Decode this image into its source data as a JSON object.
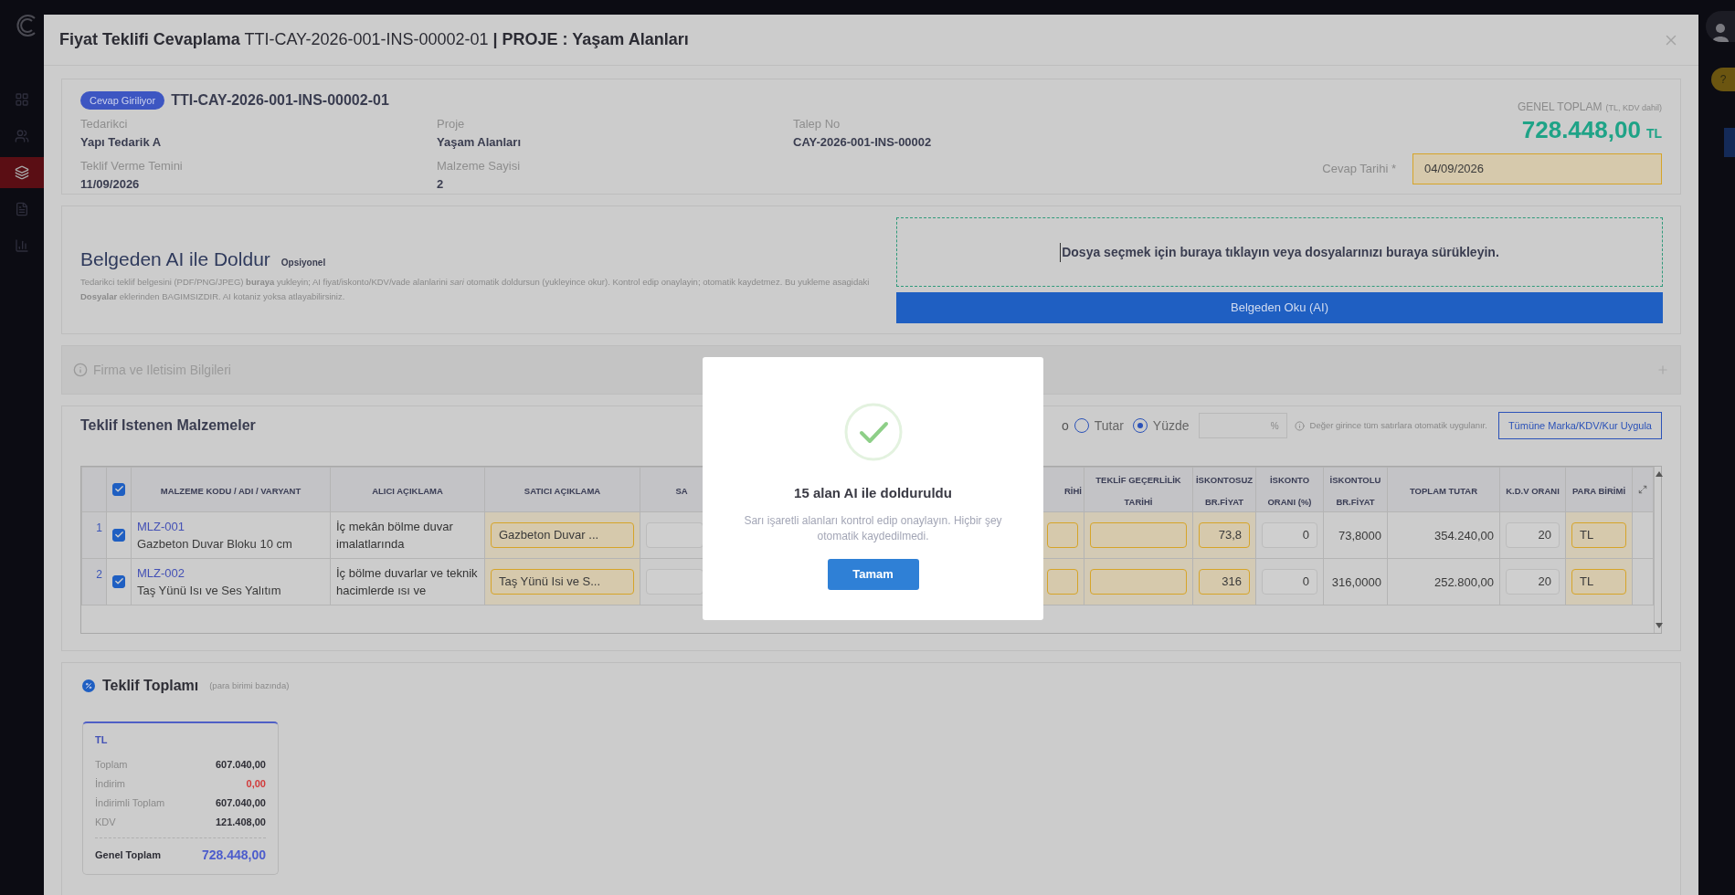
{
  "sidebar": {
    "items": [
      {
        "selected": false
      },
      {
        "selected": false
      },
      {
        "selected": true
      },
      {
        "selected": false
      },
      {
        "selected": false
      }
    ]
  },
  "help_badge": "?",
  "dialog": {
    "title": "**Fiyat Teklifi Cevaplama** TTI-CAY-2026-001-INS-00002-01 **| PROJE : Yaşam Alanları**",
    "header": {
      "status_badge": "Cevap Giriliyor",
      "reference": "TTI-CAY-2026-001-INS-00002-01",
      "fields": [
        {
          "label": "Tedarikci",
          "value": "Yapı Tedarik A"
        },
        {
          "label": "Proje",
          "value": "Yaşam Alanları"
        },
        {
          "label": "Talep No",
          "value": "CAY-2026-001-INS-00002"
        },
        {
          "label": "Teklif Verme Temini",
          "value": "11/09/2026"
        },
        {
          "label": "Malzeme Sayisi",
          "value": "2"
        }
      ],
      "grand_total": {
        "label": "GENEL TOPLAM",
        "note": "(TL, KDV dahil)",
        "amount": "728.448,00",
        "currency": "TL"
      },
      "reply_date": {
        "label": "Cevap Tarihi *",
        "value": "04/09/2026",
        "ai_filled": true
      }
    },
    "ai_fill": {
      "title": "Belgeden AI ile Doldur",
      "tag": "Opsiyonel",
      "description": "Tedarikci teklif belgesini (PDF/PNG/JPEG) **buraya** yukleyin; AI fiyat/iskonto/KDV/vade alanlarini *sari* otomatik doldursun (yukleyince okur). Kontrol edip onaylayin; otomatik kaydetmez. Bu yukleme asagidaki **Dosyalar** eklerinden BAGIMSIZDIR. AI kotaniz yoksa atlayabilirsiniz.",
      "dropzone": "Dosya seçmek için buraya tıklayın veya dosyalarınızı buraya sürükleyin.",
      "button": "Belgeden Oku (AI)"
    },
    "company_section": {
      "title": "Firma ve Iletisim Bilgileri",
      "expanded": false
    },
    "materials": {
      "title": "Teklif Istenen Malzemeler",
      "discount_label": "o",
      "discount_modes": [
        {
          "label": "Tutar",
          "selected": false
        },
        {
          "label": "Yüzde",
          "selected": true
        }
      ],
      "discount_unit": "%",
      "hint": "Değer girince tüm satırlara otomatik uygulanır.",
      "apply_button": "Tümüne Marka/KDV/Kur Uygula",
      "table": {
        "all_checked": true,
        "columns": [
          {
            "label": "MALZEME KODU / ADI / VARYANT",
            "kind": "item",
            "ai_filled": false
          },
          {
            "label": "ALICI AÇIKLAMA",
            "kind": "text",
            "ai_filled": false
          },
          {
            "label": "SATICI AÇIKLAMA",
            "kind": "input",
            "ai_filled": true
          },
          {
            "label": "SA",
            "kind": "input",
            "ai_filled": false
          },
          {
            "label": "RİHİ",
            "kind": "input",
            "ai_filled": true
          },
          {
            "label": "TEKLİF GEÇERLİLİK TARİHİ",
            "kind": "input",
            "ai_filled": true
          },
          {
            "label": "İSKONTOSUZ BR.FİYAT",
            "kind": "number_input",
            "ai_filled": true
          },
          {
            "label": "İSKONTO ORANI (%)",
            "kind": "number_input",
            "ai_filled": false
          },
          {
            "label": "İSKONTOLU BR.FİYAT",
            "kind": "number",
            "ai_filled": false
          },
          {
            "label": "TOPLAM TUTAR",
            "kind": "number",
            "ai_filled": false
          },
          {
            "label": "K.D.V ORANI",
            "kind": "number_input",
            "ai_filled": false
          },
          {
            "label": "PARA BİRİMİ",
            "kind": "input",
            "ai_filled": true
          }
        ],
        "rows": [
          {
            "number": "1",
            "checked": true,
            "cells": [
              {
                "code": "MLZ-001",
                "name": "Gazbeton Duvar Bloku 10 cm"
              },
              {
                "value": "İç mekân bölme duvar imalatlarında"
              },
              {
                "value": "Gazbeton Duvar ..."
              },
              {},
              {},
              {},
              {
                "value": "73,8"
              },
              {
                "value": "0"
              },
              {
                "value": "73,8000"
              },
              {
                "value": "354.240,00"
              },
              {
                "value": "20"
              },
              {
                "value": "TL"
              }
            ]
          },
          {
            "number": "2",
            "checked": true,
            "cells": [
              {
                "code": "MLZ-002",
                "name": "Taş Yünü Isı ve Ses Yalıtım"
              },
              {
                "value": "İç bölme duvarlar ve teknik hacimlerde ısı ve"
              },
              {
                "value": "Taş Yünü Isi ve S..."
              },
              {},
              {},
              {},
              {
                "value": "316"
              },
              {
                "value": "0"
              },
              {
                "value": "316,0000"
              },
              {
                "value": "252.800,00"
              },
              {
                "value": "20"
              },
              {
                "value": "TL"
              }
            ]
          }
        ]
      }
    },
    "totals": {
      "title": "Teklif Toplamı",
      "subtitle": "(para birimi bazında)",
      "cards": [
        {
          "currency": "TL",
          "lines": [
            {
              "label": "Toplam",
              "value": "607.040,00",
              "kind": "normal"
            },
            {
              "label": "İndirim",
              "value": "0,00",
              "kind": "discount"
            },
            {
              "label": "İndirimli Toplam",
              "value": "607.040,00",
              "kind": "normal"
            },
            {
              "label": "KDV",
              "value": "121.408,00",
              "kind": "normal"
            },
            {
              "label": "Genel Toplam",
              "value": "728.448,00",
              "kind": "grand"
            }
          ]
        }
      ]
    }
  },
  "alert": {
    "title": "15 alan AI ile dolduruldu",
    "message": "Sarı işaretli alanları kontrol edip onaylayın. Hiçbir şey otomatik kaydedilmedi.",
    "button": "Tamam"
  }
}
